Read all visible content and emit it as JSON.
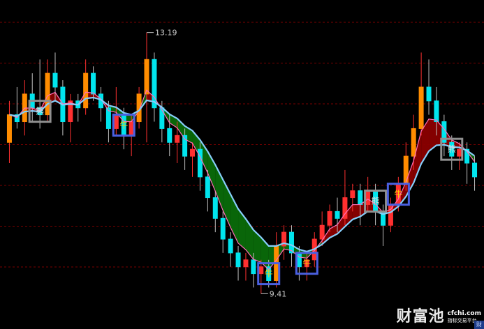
{
  "chart_data": {
    "type": "candlestick",
    "title": "",
    "y_range": [
      9.0,
      13.6
    ],
    "price_labels": {
      "high": "13.19",
      "low": "9.41"
    },
    "high_value": 13.19,
    "low_value": 9.41,
    "grid": "horizontal dashed red",
    "candles": [
      {
        "o": 11.6,
        "c": 12.0,
        "h": 12.2,
        "l": 11.3
      },
      {
        "o": 12.0,
        "c": 11.9,
        "h": 12.4,
        "l": 11.8
      },
      {
        "o": 11.9,
        "c": 12.3,
        "h": 12.5,
        "l": 11.7
      },
      {
        "o": 12.3,
        "c": 12.1,
        "h": 12.6,
        "l": 11.9
      },
      {
        "o": 12.1,
        "c": 12.0,
        "h": 12.8,
        "l": 11.8
      },
      {
        "o": 12.0,
        "c": 12.6,
        "h": 12.8,
        "l": 11.9
      },
      {
        "o": 12.6,
        "c": 12.4,
        "h": 12.9,
        "l": 12.2
      },
      {
        "o": 12.4,
        "c": 11.9,
        "h": 12.5,
        "l": 11.7
      },
      {
        "o": 11.9,
        "c": 12.2,
        "h": 12.3,
        "l": 11.6
      },
      {
        "o": 12.2,
        "c": 12.1,
        "h": 12.3,
        "l": 11.9
      },
      {
        "o": 12.1,
        "c": 12.6,
        "h": 12.8,
        "l": 12.0
      },
      {
        "o": 12.6,
        "c": 12.3,
        "h": 12.7,
        "l": 12.2
      },
      {
        "o": 12.3,
        "c": 12.1,
        "h": 12.4,
        "l": 11.9
      },
      {
        "o": 12.1,
        "c": 11.8,
        "h": 12.2,
        "l": 11.6
      },
      {
        "o": 11.8,
        "c": 12.0,
        "h": 12.4,
        "l": 11.7
      },
      {
        "o": 12.0,
        "c": 11.7,
        "h": 12.1,
        "l": 11.5
      },
      {
        "o": 11.7,
        "c": 11.9,
        "h": 12.0,
        "l": 11.4
      },
      {
        "o": 11.9,
        "c": 12.3,
        "h": 12.4,
        "l": 11.8
      },
      {
        "o": 12.3,
        "c": 12.8,
        "h": 13.19,
        "l": 11.6
      },
      {
        "o": 12.8,
        "c": 12.1,
        "h": 12.9,
        "l": 11.9
      },
      {
        "o": 12.1,
        "c": 11.8,
        "h": 12.2,
        "l": 11.6
      },
      {
        "o": 11.8,
        "c": 11.6,
        "h": 12.0,
        "l": 11.4
      },
      {
        "o": 11.6,
        "c": 11.7,
        "h": 11.9,
        "l": 11.3
      },
      {
        "o": 11.7,
        "c": 11.4,
        "h": 11.8,
        "l": 11.2
      },
      {
        "o": 11.4,
        "c": 11.5,
        "h": 11.6,
        "l": 11.1
      },
      {
        "o": 11.5,
        "c": 11.1,
        "h": 11.6,
        "l": 10.9
      },
      {
        "o": 11.1,
        "c": 10.8,
        "h": 11.2,
        "l": 10.6
      },
      {
        "o": 10.8,
        "c": 10.5,
        "h": 10.9,
        "l": 10.3
      },
      {
        "o": 10.5,
        "c": 10.2,
        "h": 10.6,
        "l": 10.0
      },
      {
        "o": 10.2,
        "c": 10.0,
        "h": 10.3,
        "l": 9.8
      },
      {
        "o": 10.0,
        "c": 9.8,
        "h": 10.1,
        "l": 9.6
      },
      {
        "o": 9.8,
        "c": 9.9,
        "h": 10.0,
        "l": 9.6
      },
      {
        "o": 9.9,
        "c": 9.7,
        "h": 10.0,
        "l": 9.5
      },
      {
        "o": 9.7,
        "c": 9.8,
        "h": 9.9,
        "l": 9.41
      },
      {
        "o": 9.8,
        "c": 9.6,
        "h": 9.9,
        "l": 9.5
      },
      {
        "o": 9.6,
        "c": 10.1,
        "h": 10.3,
        "l": 9.5
      },
      {
        "o": 10.1,
        "c": 10.3,
        "h": 10.4,
        "l": 9.9
      },
      {
        "o": 10.3,
        "c": 10.0,
        "h": 10.4,
        "l": 9.8
      },
      {
        "o": 10.0,
        "c": 9.8,
        "h": 10.1,
        "l": 9.6
      },
      {
        "o": 9.8,
        "c": 9.9,
        "h": 10.0,
        "l": 9.6
      },
      {
        "o": 9.9,
        "c": 10.2,
        "h": 10.3,
        "l": 9.8
      },
      {
        "o": 10.2,
        "c": 10.4,
        "h": 10.6,
        "l": 10.1
      },
      {
        "o": 10.4,
        "c": 10.6,
        "h": 10.7,
        "l": 10.3
      },
      {
        "o": 10.6,
        "c": 10.5,
        "h": 10.8,
        "l": 10.3
      },
      {
        "o": 10.5,
        "c": 10.8,
        "h": 11.2,
        "l": 10.4
      },
      {
        "o": 10.8,
        "c": 10.9,
        "h": 11.0,
        "l": 10.6
      },
      {
        "o": 10.9,
        "c": 10.7,
        "h": 11.0,
        "l": 10.4
      },
      {
        "o": 10.7,
        "c": 10.9,
        "h": 11.1,
        "l": 10.6
      },
      {
        "o": 10.9,
        "c": 10.6,
        "h": 11.0,
        "l": 10.4
      },
      {
        "o": 10.6,
        "c": 10.4,
        "h": 10.7,
        "l": 10.1
      },
      {
        "o": 10.4,
        "c": 10.7,
        "h": 10.8,
        "l": 10.3
      },
      {
        "o": 10.7,
        "c": 11.0,
        "h": 11.1,
        "l": 10.6
      },
      {
        "o": 11.0,
        "c": 11.4,
        "h": 11.6,
        "l": 10.9
      },
      {
        "o": 11.4,
        "c": 11.8,
        "h": 12.0,
        "l": 11.2
      },
      {
        "o": 11.8,
        "c": 12.4,
        "h": 12.9,
        "l": 11.7
      },
      {
        "o": 12.4,
        "c": 12.2,
        "h": 12.8,
        "l": 12.0
      },
      {
        "o": 12.2,
        "c": 11.9,
        "h": 12.4,
        "l": 11.7
      },
      {
        "o": 11.9,
        "c": 11.6,
        "h": 12.0,
        "l": 11.4
      },
      {
        "o": 11.6,
        "c": 11.4,
        "h": 11.7,
        "l": 11.2
      },
      {
        "o": 11.4,
        "c": 11.5,
        "h": 11.6,
        "l": 11.2
      },
      {
        "o": 11.5,
        "c": 11.3,
        "h": 11.6,
        "l": 11.0
      },
      {
        "o": 11.3,
        "c": 11.1,
        "h": 11.4,
        "l": 10.9
      }
    ],
    "signals": [
      {
        "i": 4,
        "label": "熊",
        "kind": "bear"
      },
      {
        "i": 15,
        "label": "牛",
        "kind": "bull"
      },
      {
        "i": 34,
        "label": "牛",
        "kind": "bull"
      },
      {
        "i": 39,
        "label": "牛",
        "kind": "bull"
      },
      {
        "i": 48,
        "label": "熊",
        "kind": "bear"
      },
      {
        "i": 51,
        "label": "牛",
        "kind": "bull"
      },
      {
        "i": 58,
        "label": "熊",
        "kind": "bear"
      }
    ],
    "colors": {
      "bg": "#000000",
      "up": "#ff3030",
      "down": "#00e5ee",
      "up_thick": "#ff8c00",
      "band_up": "#8b0000",
      "band_down": "#0a6b0a",
      "ma_fast": "#ff6fb8",
      "ma_slow": "#87cefa",
      "grid": "#7a0000",
      "bull_box": "#4a60e0",
      "bear_box": "#909090",
      "bull_text": "#ffd000",
      "bear_text": "#e0e0e0",
      "label": "#c8c8c8"
    }
  },
  "watermark": {
    "main": "财富池",
    "url": "cfchi.com",
    "sub": "指标交易平台",
    "tag": "财"
  }
}
